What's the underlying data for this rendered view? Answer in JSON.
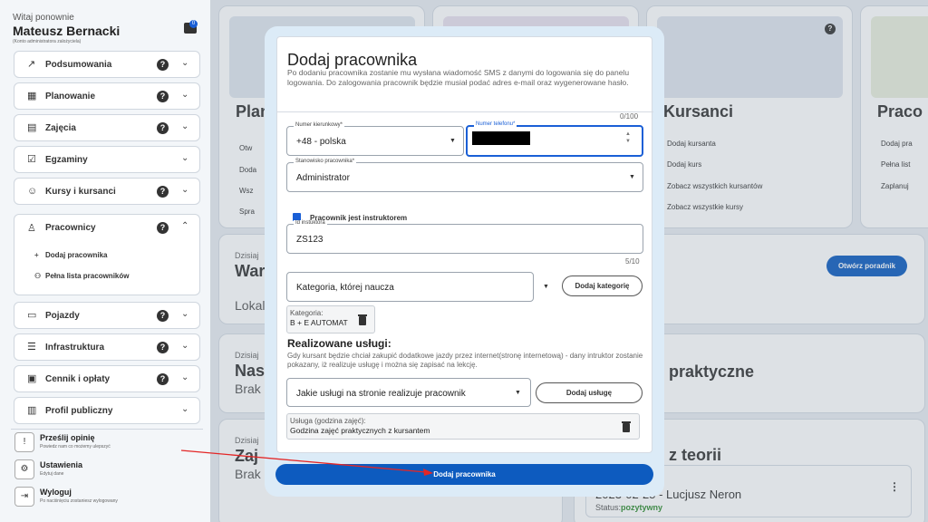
{
  "header": {
    "welcome": "Witaj ponownie",
    "user_name": "Mateusz Bernacki",
    "account_note": "(Konto administratora zalożyciela)",
    "chat_badge": "0"
  },
  "sidebar": {
    "items": [
      {
        "label": "Podsumowania",
        "icon": "trending-icon"
      },
      {
        "label": "Planowanie",
        "icon": "calendar-icon"
      },
      {
        "label": "Zajęcia",
        "icon": "clipboard-icon"
      },
      {
        "label": "Egzaminy",
        "icon": "checkbox-icon"
      },
      {
        "label": "Kursy i kursanci",
        "icon": "face-icon"
      },
      {
        "label": "Pracownicy",
        "icon": "person-icon"
      },
      {
        "label": "Pojazdy",
        "icon": "car-icon"
      },
      {
        "label": "Infrastruktura",
        "icon": "storage-icon"
      },
      {
        "label": "Cennik i opłaty",
        "icon": "money-icon"
      },
      {
        "label": "Profil publiczny",
        "icon": "bar-chart-icon"
      }
    ],
    "pracownicy_sub": [
      {
        "label": "Dodaj pracownika"
      },
      {
        "label": "Pełna lista pracowników"
      }
    ],
    "bottom": [
      {
        "title": "Prześlij opinię",
        "subtitle": "Powiedz nam co możemy ulepszyć"
      },
      {
        "title": "Ustawienia",
        "subtitle": "Edytuj dane"
      },
      {
        "title": "Wyloguj",
        "subtitle": "Po naciśnięciu zostaniesz wylogowany"
      }
    ]
  },
  "background": {
    "tile_titles": [
      "Plan",
      "Kursanci",
      "Praco"
    ],
    "plan_links": [
      "Otw",
      "Doda",
      "Wsz",
      "Spra"
    ],
    "kursanci_links": [
      "Dodaj kursanta",
      "Dodaj kurs",
      "Zobacz wszystkich kursantów",
      "Zobacz wszystkie kursy"
    ],
    "praco_links": [
      "Dodaj pra",
      "Pełna list",
      "Zaplanuj"
    ],
    "dzisiaj": "Dzisiaj",
    "card1_title": "War",
    "card1_sub": "Lokal",
    "card2_title": "Nas",
    "card2_sub": "Brak",
    "card3_title": "Zaj",
    "card3_sub": "Brak",
    "open_guide_btn": "Otwórz poradnik",
    "praktyczne": "praktyczne",
    "z_teorii": "z teorii",
    "exam_entry": "2023-02-25 - Lucjusz Neron",
    "status_label": "Status:",
    "status_value": "pozytywny"
  },
  "modal": {
    "title": "Dodaj pracownika",
    "description": "Po dodaniu pracownika zostanie mu wysłana wiadomość SMS z danymi do logowania się do panelu logowania. Do zalogowania pracownik będzie musiał podać adres e-mail oraz wygenerowane hasło.",
    "desc_counter": "0/100",
    "prefix_label": "Numer kierunkowy*",
    "prefix_value": "+48 - polska",
    "phone_label": "Numer telefonu*",
    "position_label": "Stanowisko pracownika*",
    "position_value": "Administrator",
    "instructor_checkbox": "Pracownik jest instruktorem",
    "instructor_id_label": "Id instuktora",
    "instructor_id_value": "ZS123",
    "instructor_id_counter": "5/10",
    "category_select": "Kategoria, której naucza",
    "add_category_btn": "Dodaj kategorię",
    "category_chip_label": "Kategoria:",
    "category_chip_value": "B + E AUTOMAT",
    "services_title": "Realizowane usługi:",
    "services_desc": "Gdy kursant będzie chciał zakupić dodatkowe jazdy przez internet(stronę internetową) - dany intruktor zostanie pokazany, iż realizuje usługę i można się zapisać na lekcję.",
    "service_select": "Jakie usługi na stronie realizuje pracownik",
    "add_service_btn": "Dodaj usługę",
    "service_chip_label": "Usługa (godzina zajęć):",
    "service_chip_value": "Godzina zajęć praktycznych z kursantem",
    "submit_btn": "Dodaj pracownika"
  },
  "colors": {
    "accent": "#1a5fd6",
    "primary_button": "#0d5bbf",
    "arrow": "#e32626",
    "status_positive": "#2e8b2e"
  }
}
